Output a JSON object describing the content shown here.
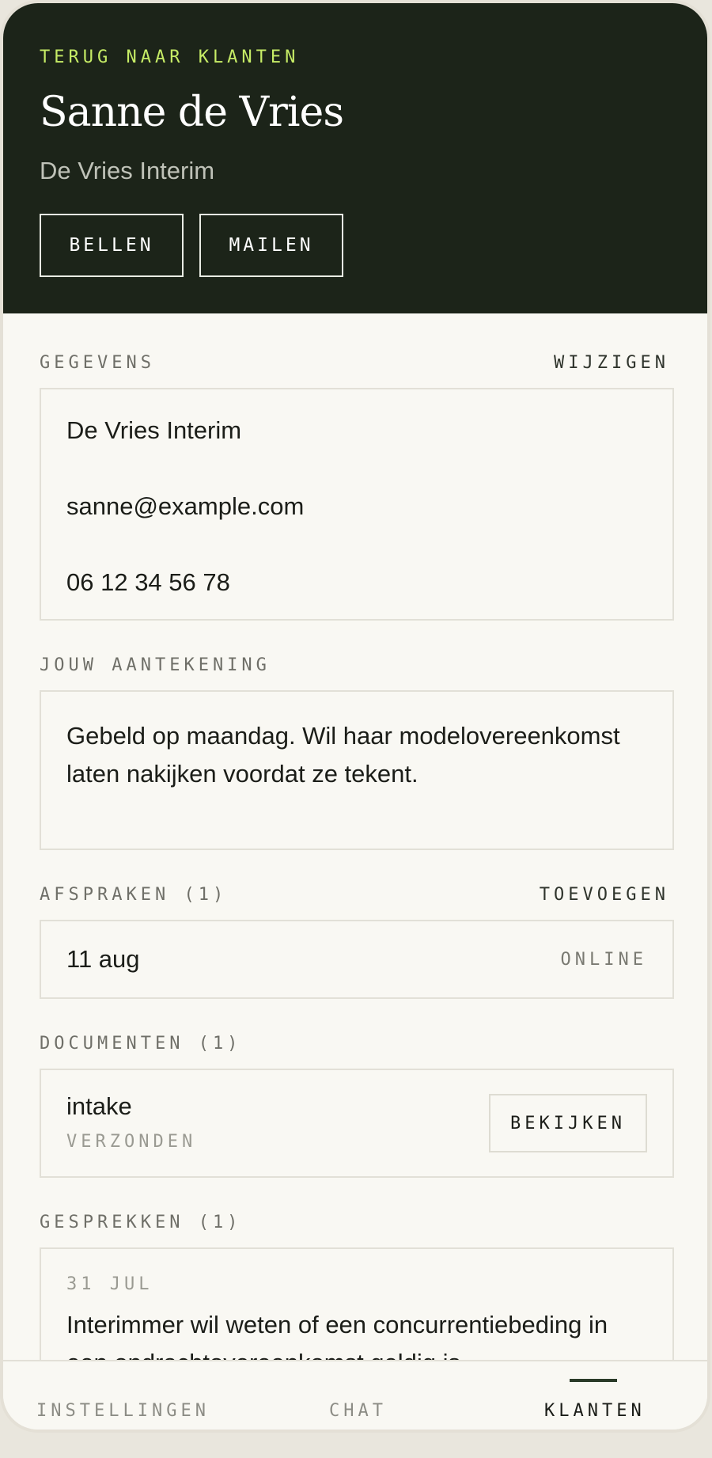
{
  "header": {
    "back_label": "TERUG NAAR KLANTEN",
    "client_name": "Sanne de Vries",
    "company": "De Vries Interim",
    "call_label": "BELLEN",
    "mail_label": "MAILEN"
  },
  "details": {
    "section_label": "GEGEVENS",
    "edit_label": "WIJZIGEN",
    "company": "De Vries Interim",
    "email": "sanne@example.com",
    "phone": "06 12 34 56 78"
  },
  "note": {
    "section_label": "JOUW AANTEKENING",
    "text": "Gebeld op maandag. Wil haar modelovereenkomst laten nakijken voordat ze tekent."
  },
  "appointments": {
    "section_label": "AFSPRAKEN (1)",
    "add_label": "TOEVOEGEN",
    "items": [
      {
        "date": "11 aug",
        "type": "ONLINE"
      }
    ]
  },
  "documents": {
    "section_label": "DOCUMENTEN (1)",
    "items": [
      {
        "name": "intake",
        "status": "VERZONDEN",
        "view_label": "BEKIJKEN"
      }
    ]
  },
  "conversations": {
    "section_label": "GESPREKKEN (1)",
    "items": [
      {
        "date": "31 JUL",
        "text": "Interimmer wil weten of een concurrentiebeding in een opdrachtovereenkomst geldig is."
      }
    ]
  },
  "tabbar": {
    "tabs": [
      "INSTELLINGEN",
      "CHAT",
      "KLANTEN"
    ],
    "active": "KLANTEN"
  },
  "colors": {
    "header_bg": "#1c2419",
    "accent_lime": "#c6ec66",
    "page_bg": "#f9f8f3"
  }
}
